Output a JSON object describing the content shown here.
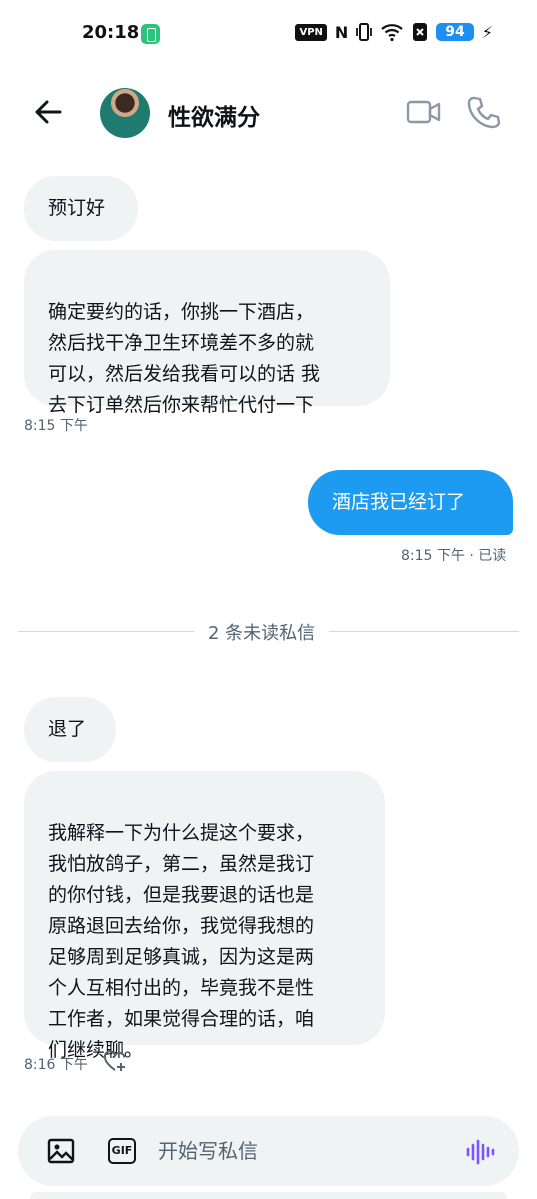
{
  "status_bar": {
    "time": "20:18",
    "vpn": "VPN",
    "nfc": "N",
    "battery": "94",
    "colors": {
      "battery": "#1d8ef2",
      "app_badge": "#2ec27e"
    }
  },
  "header": {
    "title": "性欲满分",
    "back_icon": "arrow-left-icon",
    "video_icon": "video-camera-icon",
    "call_icon": "phone-icon"
  },
  "messages": [
    {
      "direction": "in",
      "text": "预订好"
    },
    {
      "direction": "in",
      "text": "确定要约的话，你挑一下酒店，\n然后找干净卫生环境差不多的就\n可以，然后发给我看可以的话 我\n去下订单然后你来帮忙代付一下",
      "time": "8:15 下午"
    },
    {
      "direction": "out",
      "text": "酒店我已经订了",
      "time": "8:15 下午 · 已读"
    },
    {
      "direction": "in",
      "text": "退了"
    },
    {
      "direction": "in",
      "text": "我解释一下为什么提这个要求，\n我怕放鸽子，第二，虽然是我订\n的你付钱，但是我要退的话也是\n原路退回去给你，我觉得我想的\n足够周到足够真诚，因为这是两\n个人互相付出的，毕竟我不是性\n工作者，如果觉得合理的话，咱\n们继续聊。",
      "time": "8:16 下午"
    }
  ],
  "unread_divider": "2 条未读私信",
  "composer": {
    "placeholder": "开始写私信",
    "gif_label": "GIF",
    "image_icon": "image-icon",
    "voice_icon": "voice-wave-icon"
  },
  "colors": {
    "accent": "#1d9bf0",
    "bubble_in": "#eff3f4",
    "meta_text": "#536471",
    "voice_icon": "#7856ff"
  }
}
